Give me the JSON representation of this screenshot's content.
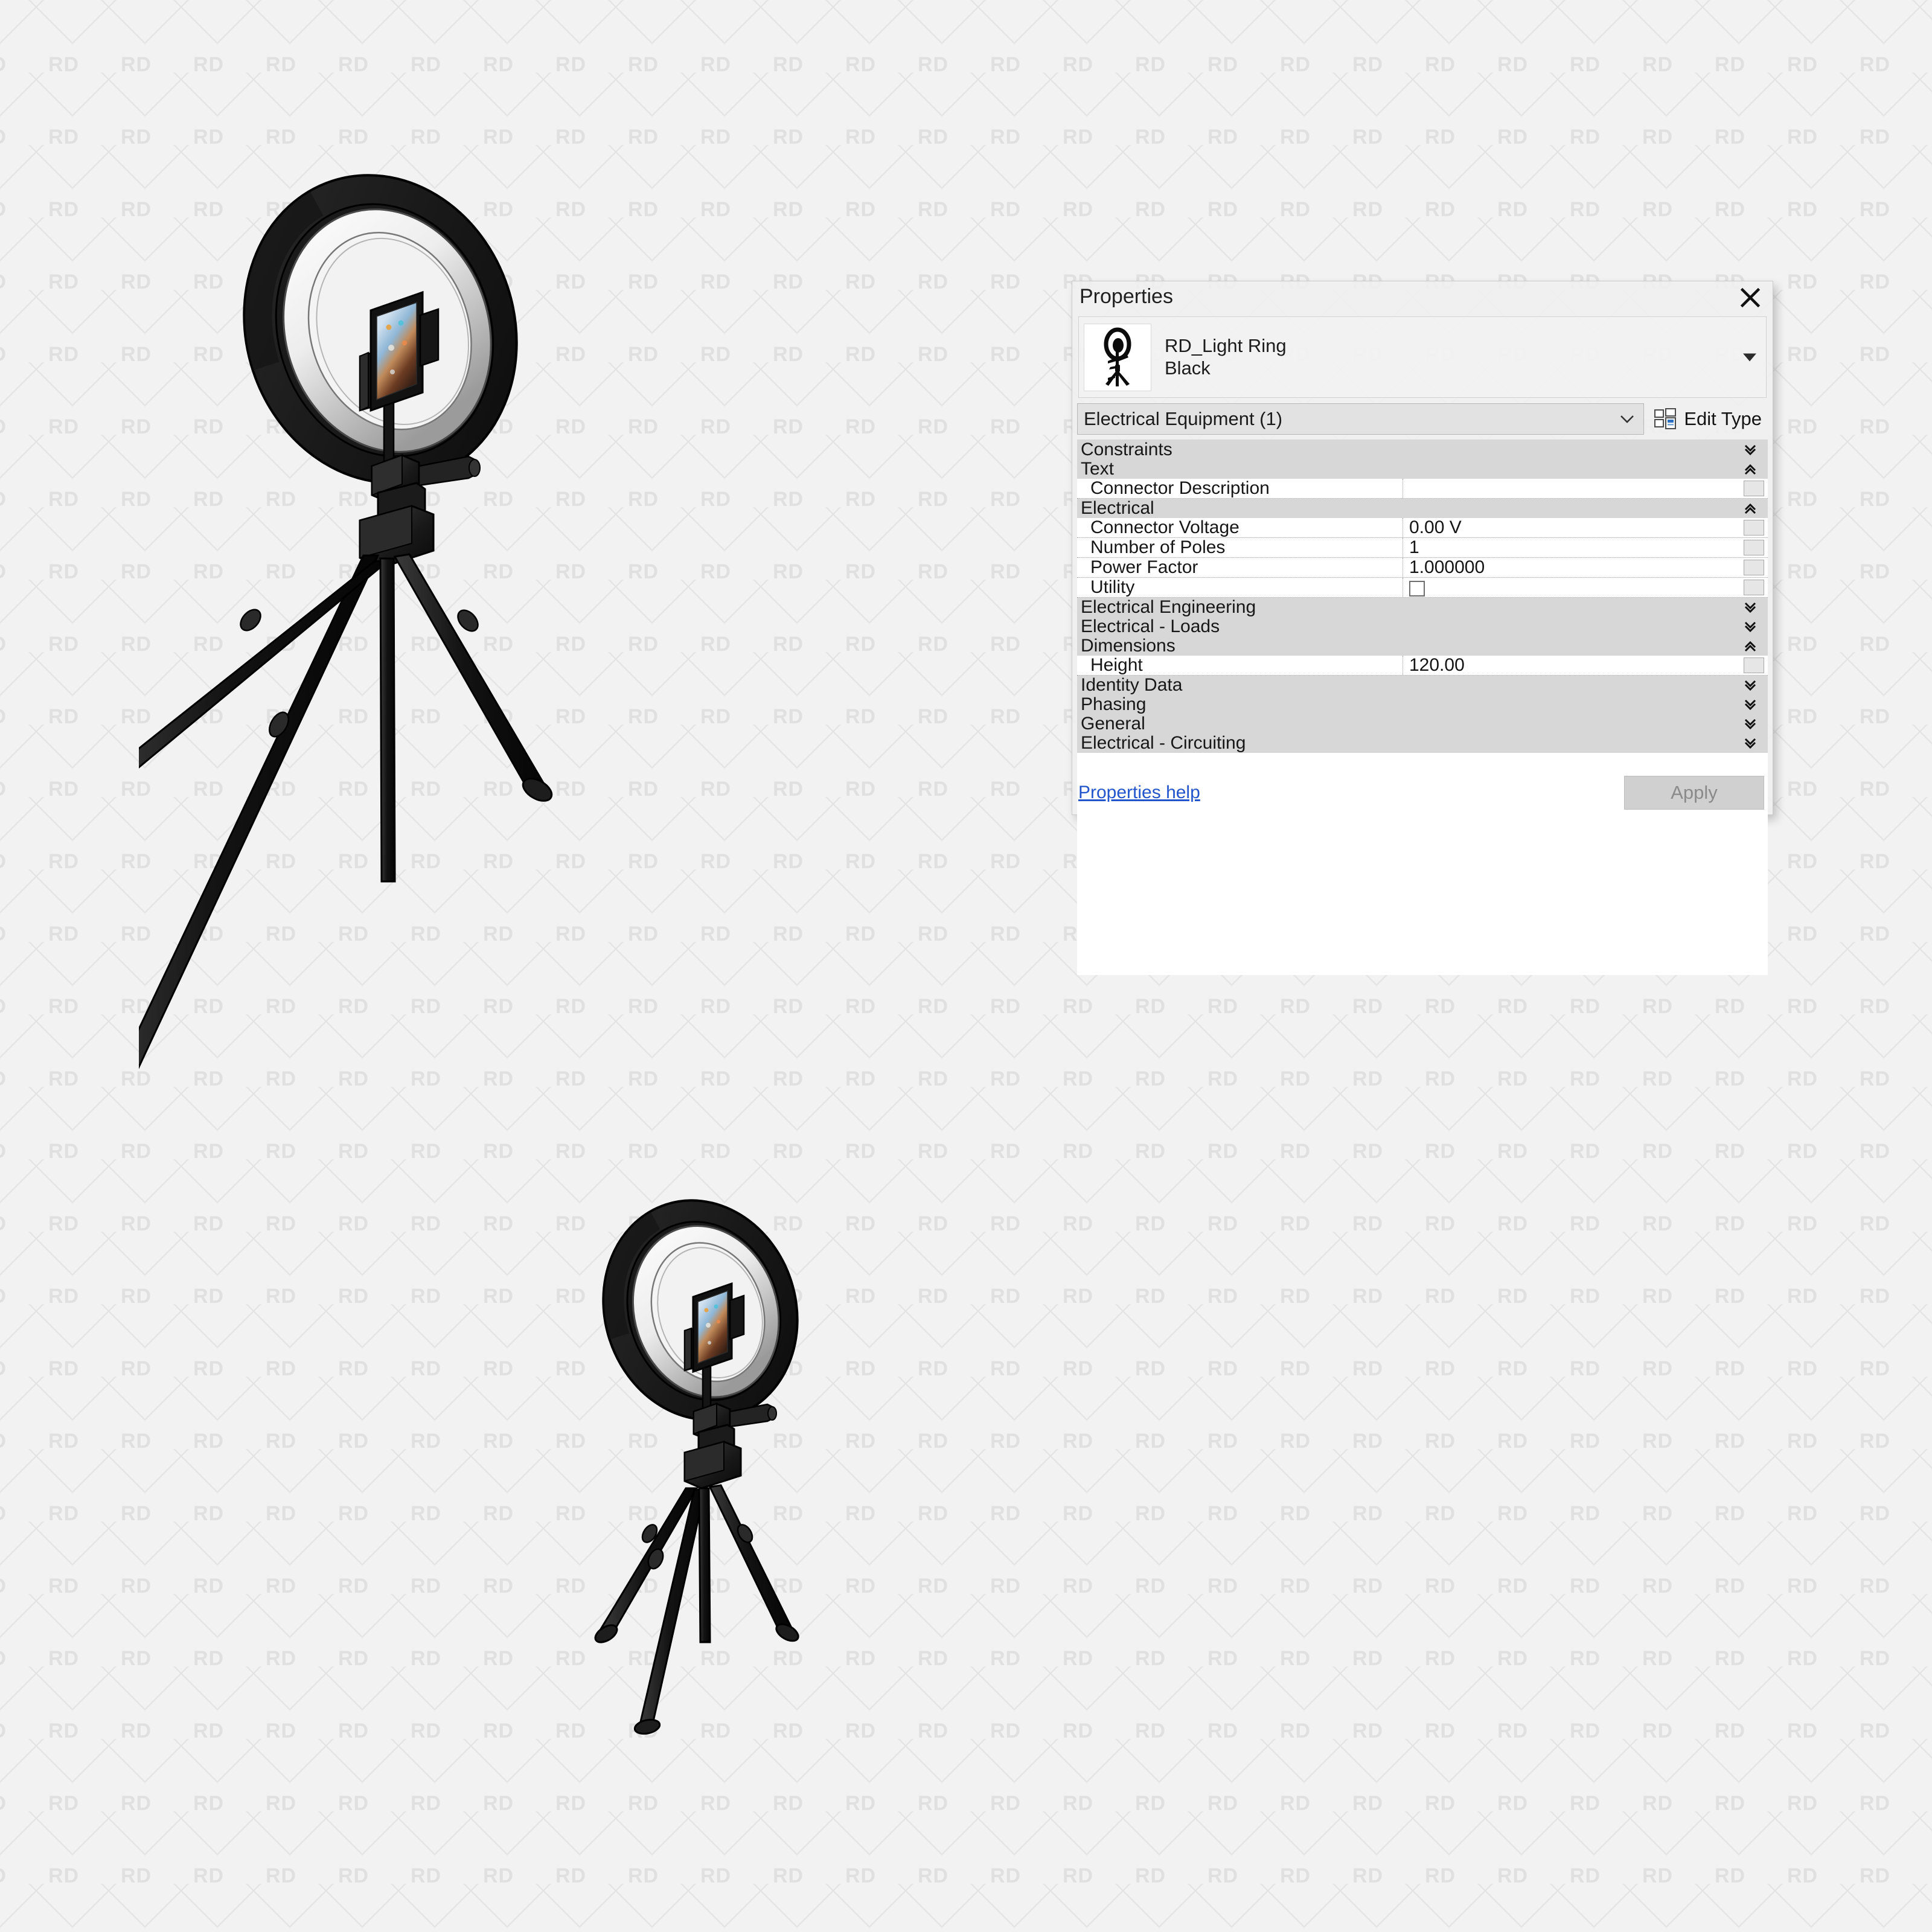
{
  "watermark": {
    "text": "RD"
  },
  "panel": {
    "title": "Properties",
    "close_icon": "close-icon",
    "type_name": "RD_Light Ring Black",
    "type_name_line1": "RD_Light Ring",
    "type_name_line2": "Black",
    "thumbnail_icon": "ring-light-thumbnail",
    "category": "Electrical Equipment (1)",
    "edit_type_label": "Edit Type",
    "edit_type_icon": "edit-type-icon",
    "help_link": "Properties help",
    "apply_label": "Apply",
    "accent_link_color": "#2255cc",
    "group_header_bg": "#d7d7d7",
    "panel_bg": "#f0f0f0"
  },
  "parameters": [
    {
      "kind": "group",
      "label": "Constraints",
      "state": "collapsed"
    },
    {
      "kind": "group",
      "label": "Text",
      "state": "expanded"
    },
    {
      "kind": "value",
      "name": "Connector Description",
      "value": "",
      "type": "text"
    },
    {
      "kind": "group",
      "label": "Electrical",
      "state": "expanded"
    },
    {
      "kind": "value",
      "name": "Connector Voltage",
      "value": "0.00 V",
      "type": "text"
    },
    {
      "kind": "value",
      "name": "Number of Poles",
      "value": "1",
      "type": "text"
    },
    {
      "kind": "value",
      "name": "Power Factor",
      "value": "1.000000",
      "type": "text"
    },
    {
      "kind": "value",
      "name": "Utility",
      "value": "",
      "type": "checkbox",
      "checked": false
    },
    {
      "kind": "group",
      "label": "Electrical Engineering",
      "state": "collapsed"
    },
    {
      "kind": "group",
      "label": "Electrical - Loads",
      "state": "collapsed"
    },
    {
      "kind": "group",
      "label": "Dimensions",
      "state": "expanded"
    },
    {
      "kind": "value",
      "name": "Height",
      "value": "120.00",
      "type": "text"
    },
    {
      "kind": "group",
      "label": "Identity Data",
      "state": "collapsed"
    },
    {
      "kind": "group",
      "label": "Phasing",
      "state": "collapsed"
    },
    {
      "kind": "group",
      "label": "General",
      "state": "collapsed"
    },
    {
      "kind": "group",
      "label": "Electrical - Circuiting",
      "state": "collapsed"
    }
  ],
  "illustrations": [
    {
      "name": "ring-light-floor-tripod",
      "description": "Ring light on tall floor tripod with phone holder"
    },
    {
      "name": "ring-light-desk-tripod",
      "description": "Ring light on small desk tripod with phone holder"
    }
  ]
}
